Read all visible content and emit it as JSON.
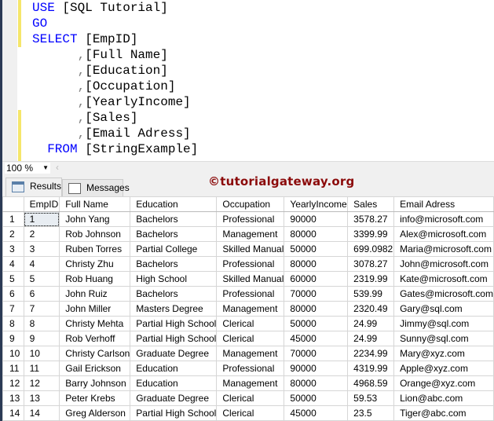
{
  "editor": {
    "lines": [
      {
        "kw": "USE",
        "rest": " [SQL Tutorial]",
        "indent": ""
      },
      {
        "kw": "GO",
        "rest": "",
        "indent": ""
      },
      {
        "kw": "SELECT",
        "rest": " [EmpID]",
        "indent": ""
      },
      {
        "kw": "",
        "rest": "[Full Name]",
        "indent": "      ,"
      },
      {
        "kw": "",
        "rest": "[Education]",
        "indent": "      ,"
      },
      {
        "kw": "",
        "rest": "[Occupation]",
        "indent": "      ,"
      },
      {
        "kw": "",
        "rest": "[YearlyIncome]",
        "indent": "      ,"
      },
      {
        "kw": "",
        "rest": "[Sales]",
        "indent": "      ,"
      },
      {
        "kw": "",
        "rest": "[Email Adress]",
        "indent": "      ,"
      },
      {
        "kw": "FROM",
        "rest": " [StringExample]",
        "indent": "  "
      }
    ]
  },
  "zoom": {
    "value": "100 %"
  },
  "tabs": {
    "results": "Results",
    "messages": "Messages"
  },
  "watermark": "©tutorialgateway.org",
  "grid": {
    "columns": [
      "",
      "EmpID",
      "Full Name",
      "Education",
      "Occupation",
      "YearlyIncome",
      "Sales",
      "Email Adress"
    ],
    "rows": [
      [
        "1",
        "1",
        "John Yang",
        "Bachelors",
        "Professional",
        "90000",
        "3578.27",
        "info@microsoft.com"
      ],
      [
        "2",
        "2",
        "Rob Johnson",
        "Bachelors",
        "Management",
        "80000",
        "3399.99",
        "Alex@microsoft.com"
      ],
      [
        "3",
        "3",
        "Ruben Torres",
        "Partial College",
        "Skilled Manual",
        "50000",
        "699.0982",
        "Maria@microsoft.com"
      ],
      [
        "4",
        "4",
        "Christy Zhu",
        "Bachelors",
        "Professional",
        "80000",
        "3078.27",
        "John@microsoft.com"
      ],
      [
        "5",
        "5",
        "Rob Huang",
        "High School",
        "Skilled Manual",
        "60000",
        "2319.99",
        "Kate@microsoft.com"
      ],
      [
        "6",
        "6",
        "John Ruiz",
        "Bachelors",
        "Professional",
        "70000",
        "539.99",
        "Gates@microsoft.com"
      ],
      [
        "7",
        "7",
        "John Miller",
        "Masters Degree",
        "Management",
        "80000",
        "2320.49",
        "Gary@sql.com"
      ],
      [
        "8",
        "8",
        "Christy Mehta",
        "Partial High School",
        "Clerical",
        "50000",
        "24.99",
        "Jimmy@sql.com"
      ],
      [
        "9",
        "9",
        "Rob Verhoff",
        "Partial High School",
        "Clerical",
        "45000",
        "24.99",
        "Sunny@sql.com"
      ],
      [
        "10",
        "10",
        "Christy Carlson",
        "Graduate Degree",
        "Management",
        "70000",
        "2234.99",
        "Mary@xyz.com"
      ],
      [
        "11",
        "11",
        "Gail Erickson",
        "Education",
        "Professional",
        "90000",
        "4319.99",
        "Apple@xyz.com"
      ],
      [
        "12",
        "12",
        "Barry Johnson",
        "Education",
        "Management",
        "80000",
        "4968.59",
        "Orange@xyz.com"
      ],
      [
        "13",
        "13",
        "Peter Krebs",
        "Graduate Degree",
        "Clerical",
        "50000",
        "59.53",
        "Lion@abc.com"
      ],
      [
        "14",
        "14",
        "Greg Alderson",
        "Partial High School",
        "Clerical",
        "45000",
        "23.5",
        "Tiger@abc.com"
      ]
    ]
  }
}
